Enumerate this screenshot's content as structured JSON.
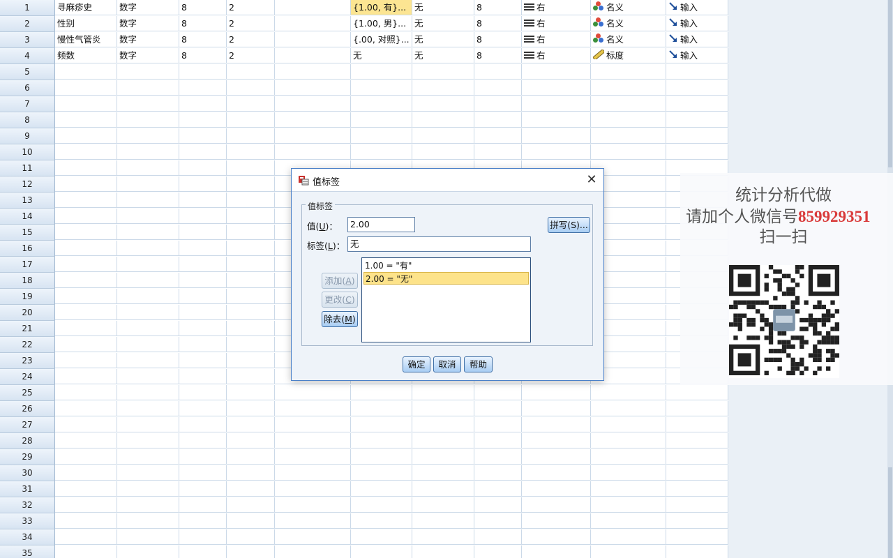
{
  "grid": {
    "rows": [
      {
        "num": "1",
        "name": "寻麻疹史",
        "type": "数字",
        "width": "8",
        "decimals": "2",
        "label": "",
        "values": "{1.00, 有}...",
        "missing": "无",
        "columns": "8",
        "align": "右",
        "measure": "名义",
        "role": "输入"
      },
      {
        "num": "2",
        "name": "性别",
        "type": "数字",
        "width": "8",
        "decimals": "2",
        "label": "",
        "values": "{1.00, 男}...",
        "missing": "无",
        "columns": "8",
        "align": "右",
        "measure": "名义",
        "role": "输入"
      },
      {
        "num": "3",
        "name": "慢性气管炎",
        "type": "数字",
        "width": "8",
        "decimals": "2",
        "label": "",
        "values": "{.00, 对照}...",
        "missing": "无",
        "columns": "8",
        "align": "右",
        "measure": "名义",
        "role": "输入"
      },
      {
        "num": "4",
        "name": "频数",
        "type": "数字",
        "width": "8",
        "decimals": "2",
        "label": "",
        "values": "无",
        "missing": "无",
        "columns": "8",
        "align": "右",
        "measure": "标度",
        "role": "输入"
      }
    ],
    "empty_row_numbers": [
      "5",
      "6",
      "7",
      "8",
      "9",
      "10",
      "11",
      "12",
      "13",
      "14",
      "15",
      "16",
      "17",
      "18",
      "19",
      "20",
      "21",
      "22",
      "23",
      "24",
      "25",
      "26",
      "27",
      "28",
      "29",
      "30",
      "31",
      "32",
      "33",
      "34",
      "35"
    ]
  },
  "dialog": {
    "title": "值标签",
    "group_label": "值标签",
    "value_label_text": "值(",
    "value_label_key": "U",
    "value_label_end": ")：",
    "value_input": "2.00",
    "label_label_text": "标签(",
    "label_label_key": "L",
    "label_label_end": ")：",
    "label_input": "无",
    "spell_button": "拼写(S)...",
    "add_button_text": "添加(",
    "add_button_key": "A",
    "change_button_text": "更改(",
    "change_button_key": "C",
    "remove_button_text": "除去(",
    "remove_button_key": "M",
    "btn_close": ")",
    "list_items": [
      "1.00 = \"有\"",
      "2.00 = \"无\""
    ],
    "ok_button": "确定",
    "cancel_button": "取消",
    "help_button": "帮助",
    "close_glyph": "✕"
  },
  "watermark": {
    "line1": "统计分析代做",
    "line2_prefix": "请加个人微信号",
    "line2_number": "859929351",
    "line3": "扫一扫"
  },
  "colors": {
    "selected_cell": "#fce592",
    "dialog_accent": "#4a80c8",
    "watermark_number": "#d93a3a"
  }
}
